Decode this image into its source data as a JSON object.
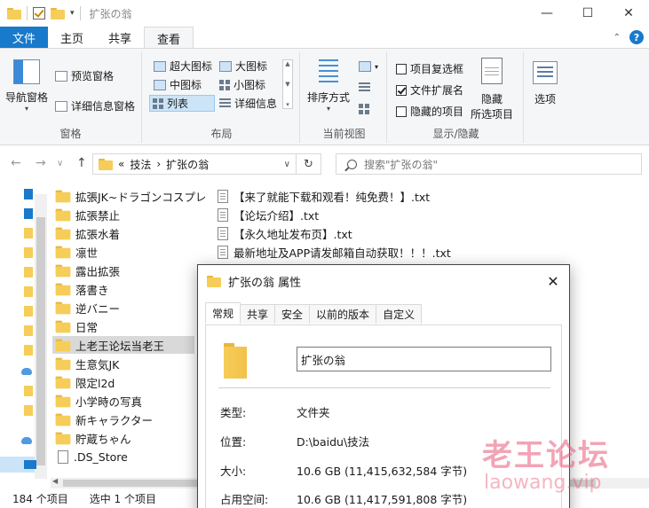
{
  "window": {
    "title": "扩张の翁",
    "controls": {
      "minimize": "—",
      "maximize": "☐",
      "close": "✕"
    }
  },
  "ribbon": {
    "tabs": [
      "文件",
      "主页",
      "共享",
      "查看"
    ],
    "active_tab": "查看",
    "help": "?",
    "groups": {
      "panes": {
        "label": "窗格",
        "nav_pane": "导航窗格",
        "preview": "预览窗格",
        "details": "详细信息窗格"
      },
      "layout": {
        "label": "布局",
        "items": [
          "超大图标",
          "大图标",
          "中图标",
          "小图标",
          "列表",
          "详细信息"
        ],
        "selected": "列表"
      },
      "current_view": {
        "label": "当前视图",
        "sort": "排序方式"
      },
      "show_hide": {
        "label": "显示/隐藏",
        "item_checkbox": {
          "label": "项目复选框",
          "checked": false
        },
        "file_ext": {
          "label": "文件扩展名",
          "checked": true
        },
        "hidden_items": {
          "label": "隐藏的项目",
          "checked": false
        },
        "hide_selected": [
          "隐藏",
          "所选项目"
        ]
      },
      "options": {
        "label": "选项"
      }
    }
  },
  "nav": {
    "back": "←",
    "forward": "→",
    "recent": "∨",
    "up": "↑",
    "breadcrumb": [
      "«",
      "技法",
      "›",
      "扩张の翁"
    ],
    "refresh": "↻",
    "search_placeholder": "搜索\"扩张の翁\""
  },
  "files_col1": [
    {
      "name": "拡張JK~ドラゴンコスプレ",
      "type": "folder"
    },
    {
      "name": "拡張禁止",
      "type": "folder"
    },
    {
      "name": "拡張水着",
      "type": "folder"
    },
    {
      "name": "凛世",
      "type": "folder"
    },
    {
      "name": "露出拡張",
      "type": "folder"
    },
    {
      "name": "落書き",
      "type": "folder"
    },
    {
      "name": "逆バニー",
      "type": "folder"
    },
    {
      "name": "日常",
      "type": "folder"
    },
    {
      "name": "上老王论坛当老王",
      "type": "folder",
      "selected": true
    },
    {
      "name": "生意気JK",
      "type": "folder"
    },
    {
      "name": "限定l2d",
      "type": "folder"
    },
    {
      "name": "小学時の写真",
      "type": "folder"
    },
    {
      "name": "新キャラクター",
      "type": "folder"
    },
    {
      "name": "貯蔵ちゃん",
      "type": "folder"
    },
    {
      "name": ".DS_Store",
      "type": "file"
    }
  ],
  "files_col2": [
    {
      "name": "【来了就能下载和观看！纯免费！】.txt"
    },
    {
      "name": "【论坛介绍】.txt"
    },
    {
      "name": "【永久地址发布页】.txt"
    },
    {
      "name": "最新地址及APP请发邮箱自动获取！！！.txt"
    }
  ],
  "status": {
    "count": "184 个项目",
    "selected": "选中 1 个项目"
  },
  "dialog": {
    "title": "扩张の翁 属性",
    "close": "✕",
    "tabs": [
      "常规",
      "共享",
      "安全",
      "以前的版本",
      "自定义"
    ],
    "active_tab": "常规",
    "name_value": "扩张の翁",
    "props": [
      {
        "label": "类型:",
        "value": "文件夹"
      },
      {
        "label": "位置:",
        "value": "D:\\baidu\\技法"
      },
      {
        "label": "大小:",
        "value": "10.6 GB (11,415,632,584 字节)"
      },
      {
        "label": "占用空间:",
        "value": "10.6 GB (11,417,591,808 字节)"
      }
    ]
  },
  "watermark": {
    "line1": "老王论坛",
    "line2": "laowang.vip"
  }
}
